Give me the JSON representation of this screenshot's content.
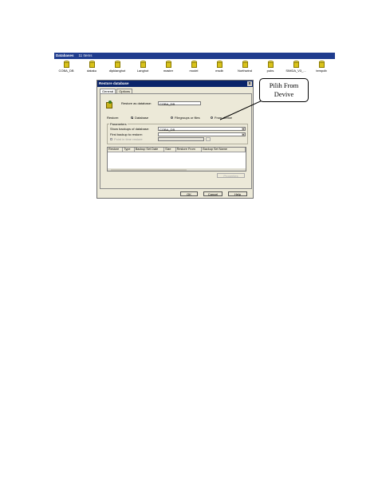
{
  "databases_bar": {
    "title": "Databases",
    "count": "11 Items"
  },
  "databases": [
    "COBA_DB",
    "dataku",
    "dipklanghot",
    "Langhot",
    "master",
    "model",
    "msdb",
    "Northwind",
    "pubs",
    "SIMDA_V3_...",
    "tempdb"
  ],
  "dialog": {
    "title": "Restore database",
    "close": "x",
    "tabs": [
      "General",
      "Options"
    ],
    "restore_as_label": "Restore as database:",
    "restore_as_value": "COBA_DB",
    "restore_label": "Restore:",
    "restore_options": [
      "Database",
      "Filegroups or files",
      "From device"
    ],
    "selected_restore_option": "Database",
    "parameters_legend": "Parameters",
    "show_backups_label": "Show backups of database:",
    "show_backups_value": "COBA_DB",
    "first_backup_label": "First backup to restore:",
    "first_backup_value": "",
    "point_in_time_label": "Point in time restore",
    "table_columns": [
      "Restore",
      "Type",
      "Backup Set Date",
      "Size",
      "Restore From",
      "Backup Set Name"
    ],
    "properties_button": "Properties",
    "buttons": [
      "OK",
      "Cancel",
      "Help"
    ]
  },
  "callout": {
    "line1": "Pilih From",
    "line2": "Devive"
  }
}
